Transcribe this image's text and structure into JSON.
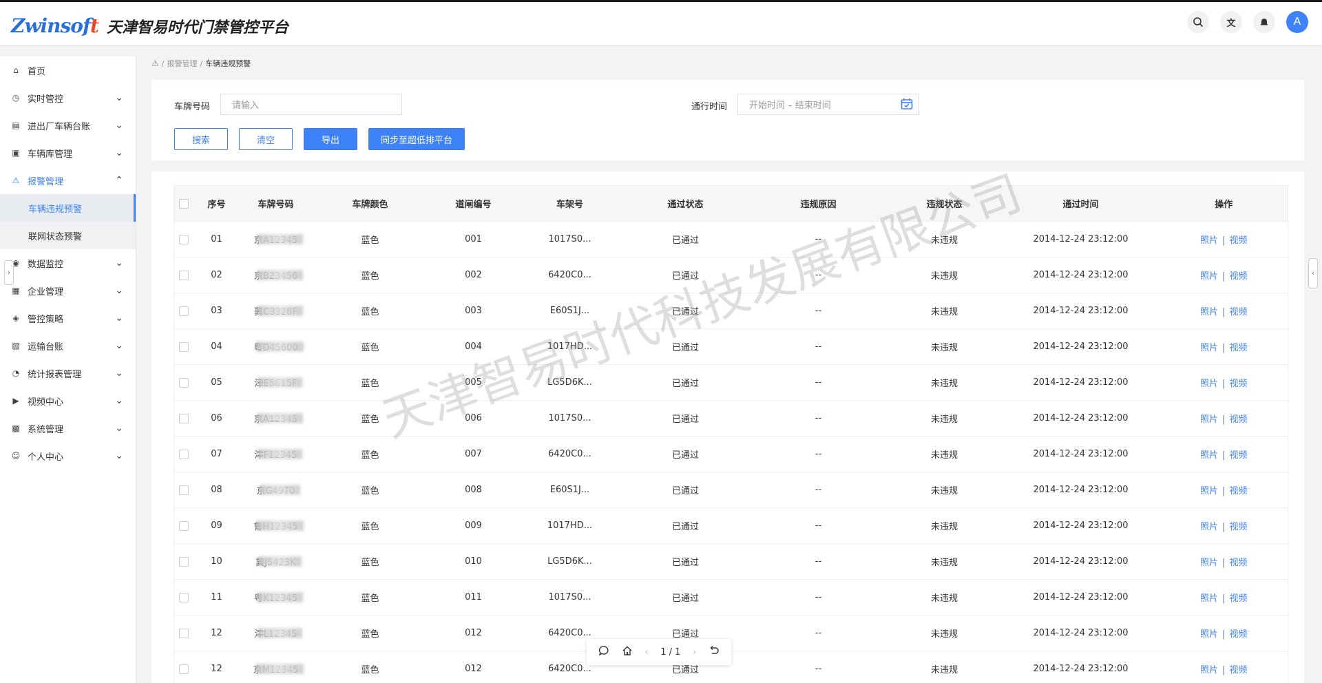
{
  "header": {
    "logo_text": "Zwinsoft",
    "title": "天津智易时代门禁管控平台",
    "avatar_letter": "A",
    "icons": [
      "search-icon",
      "translate-icon",
      "bell-icon"
    ]
  },
  "sidebar": {
    "items": [
      {
        "label": "首页",
        "icon": "home-icon",
        "glyph": "⌂",
        "expandable": false,
        "active": false
      },
      {
        "label": "实时管控",
        "icon": "alarm-clock-icon",
        "glyph": "◷",
        "expandable": true,
        "active": false
      },
      {
        "label": "进出厂车辆台账",
        "icon": "ledger-icon",
        "glyph": "▤",
        "expandable": true,
        "active": false
      },
      {
        "label": "车辆库管理",
        "icon": "vehicle-library-icon",
        "glyph": "▣",
        "expandable": true,
        "active": false
      },
      {
        "label": "报警管理",
        "icon": "alarm-icon",
        "glyph": "⚠",
        "expandable": true,
        "active": true,
        "open": true,
        "children": [
          {
            "label": "车辆违规预警",
            "active": true
          },
          {
            "label": "联网状态预警",
            "active": false
          }
        ]
      },
      {
        "label": "数据监控",
        "icon": "monitor-icon",
        "glyph": "◉",
        "expandable": true,
        "active": false
      },
      {
        "label": "企业管理",
        "icon": "enterprise-icon",
        "glyph": "▦",
        "expandable": true,
        "active": false
      },
      {
        "label": "管控策略",
        "icon": "shield-icon",
        "glyph": "◈",
        "expandable": true,
        "active": false
      },
      {
        "label": "运输台账",
        "icon": "transport-icon",
        "glyph": "▧",
        "expandable": true,
        "active": false
      },
      {
        "label": "统计报表管理",
        "icon": "gauge-icon",
        "glyph": "◔",
        "expandable": true,
        "active": false
      },
      {
        "label": "视频中心",
        "icon": "video-icon",
        "glyph": "▶",
        "expandable": true,
        "active": false
      },
      {
        "label": "系统管理",
        "icon": "grid-icon",
        "glyph": "▩",
        "expandable": true,
        "active": false
      },
      {
        "label": "个人中心",
        "icon": "user-icon",
        "glyph": "☺",
        "expandable": true,
        "active": false
      }
    ]
  },
  "breadcrumb": {
    "level1": "报警管理",
    "current": "车辆违规预警",
    "separator": "/"
  },
  "filters": {
    "plate_label": "车牌号码",
    "plate_placeholder": "请输入",
    "time_label": "通行时间",
    "time_placeholder": "开始时间 – 结束时间"
  },
  "buttons": {
    "search": "搜索",
    "clear": "清空",
    "export": "导出",
    "sync": "同步至超低排平台"
  },
  "table": {
    "headers": [
      "序号",
      "车牌号码",
      "车牌颜色",
      "道闸编号",
      "车架号",
      "通过状态",
      "违规原因",
      "违规状态",
      "通过时间",
      "操作"
    ],
    "rows": [
      {
        "seq": "01",
        "plate": "京A12345",
        "color": "蓝色",
        "gate": "001",
        "vin": "1017S0...",
        "pass": "已通过",
        "reason": "--",
        "status": "未违规",
        "time": "2014-12-24  23:12:00"
      },
      {
        "seq": "02",
        "plate": "京B23456",
        "color": "蓝色",
        "gate": "002",
        "vin": "6420C0...",
        "pass": "已通过",
        "reason": "--",
        "status": "未违规",
        "time": "2014-12-24  23:12:00"
      },
      {
        "seq": "03",
        "plate": "冀C3328F",
        "color": "蓝色",
        "gate": "003",
        "vin": "E60S1J...",
        "pass": "已通过",
        "reason": "--",
        "status": "未违规",
        "time": "2014-12-24  23:12:00"
      },
      {
        "seq": "04",
        "plate": "粤D45600",
        "color": "蓝色",
        "gate": "004",
        "vin": "1017HD...",
        "pass": "已通过",
        "reason": "--",
        "status": "未违规",
        "time": "2014-12-24  23:12:00"
      },
      {
        "seq": "05",
        "plate": "津E5615F",
        "color": "蓝色",
        "gate": "005",
        "vin": "LG5D6K...",
        "pass": "已通过",
        "reason": "--",
        "status": "未违规",
        "time": "2014-12-24  23:12:00"
      },
      {
        "seq": "06",
        "plate": "京A12345",
        "color": "蓝色",
        "gate": "006",
        "vin": "1017S0...",
        "pass": "已通过",
        "reason": "--",
        "status": "未违规",
        "time": "2014-12-24  23:12:00"
      },
      {
        "seq": "07",
        "plate": "津F12345",
        "color": "蓝色",
        "gate": "007",
        "vin": "6420C0...",
        "pass": "已通过",
        "reason": "--",
        "status": "未违规",
        "time": "2014-12-24  23:12:00"
      },
      {
        "seq": "08",
        "plate": "京G49T0",
        "color": "蓝色",
        "gate": "008",
        "vin": "E60S1J...",
        "pass": "已通过",
        "reason": "--",
        "status": "未违规",
        "time": "2014-12-24  23:12:00"
      },
      {
        "seq": "09",
        "plate": "鲁H12345",
        "color": "蓝色",
        "gate": "009",
        "vin": "1017HD...",
        "pass": "已通过",
        "reason": "--",
        "status": "未违规",
        "time": "2014-12-24  23:12:00"
      },
      {
        "seq": "10",
        "plate": "冀J5423K",
        "color": "蓝色",
        "gate": "010",
        "vin": "LG5D6K...",
        "pass": "已通过",
        "reason": "--",
        "status": "未违规",
        "time": "2014-12-24  23:12:00"
      },
      {
        "seq": "11",
        "plate": "粤K12345",
        "color": "蓝色",
        "gate": "011",
        "vin": "1017S0...",
        "pass": "已通过",
        "reason": "--",
        "status": "未违规",
        "time": "2014-12-24  23:12:00"
      },
      {
        "seq": "12",
        "plate": "津L12345",
        "color": "蓝色",
        "gate": "012",
        "vin": "6420C0...",
        "pass": "已通过",
        "reason": "--",
        "status": "未违规",
        "time": "2014-12-24  23:12:00"
      },
      {
        "seq": "12",
        "plate": "京M12345",
        "color": "蓝色",
        "gate": "012",
        "vin": "6420C0...",
        "pass": "已通过",
        "reason": "--",
        "status": "未违规",
        "time": "2014-12-24  23:12:00"
      }
    ],
    "op_photo": "照片",
    "op_video": "视频",
    "op_sep": "|"
  },
  "watermark": "天津智易时代科技发展有限公司",
  "float_toolbar": {
    "page_indicator": "1 / 1"
  },
  "colors": {
    "accent": "#3e82f7",
    "sidebar_active_bg": "#e8ebf0",
    "logo_red": "#e4492b"
  }
}
